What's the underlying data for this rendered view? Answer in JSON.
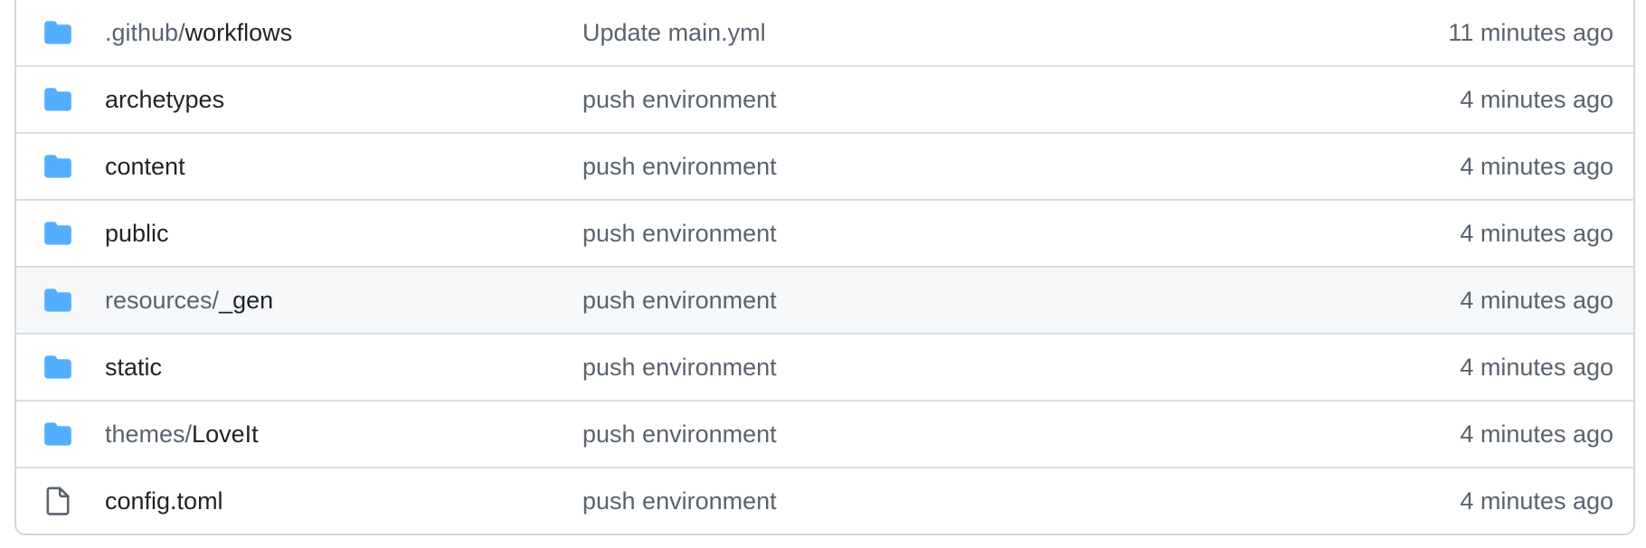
{
  "colors": {
    "folder_icon": "#54aeff",
    "file_icon": "#59636e",
    "text_primary": "#1f2328",
    "text_muted": "#59636e",
    "border": "#d0d7de",
    "hover_row": "#f6f8fa"
  },
  "rows": [
    {
      "type": "folder",
      "icon": "folder-icon",
      "prefix": ".github/",
      "name": "workflows",
      "message": "Update main.yml",
      "age": "11 minutes ago"
    },
    {
      "type": "folder",
      "icon": "folder-icon",
      "prefix": "",
      "name": "archetypes",
      "message": "push environment",
      "age": "4 minutes ago"
    },
    {
      "type": "folder",
      "icon": "folder-icon",
      "prefix": "",
      "name": "content",
      "message": "push environment",
      "age": "4 minutes ago"
    },
    {
      "type": "folder",
      "icon": "folder-icon",
      "prefix": "",
      "name": "public",
      "message": "push environment",
      "age": "4 minutes ago"
    },
    {
      "type": "folder",
      "icon": "folder-icon",
      "prefix": "resources/",
      "name": "_gen",
      "message": "push environment",
      "age": "4 minutes ago",
      "hovered": true
    },
    {
      "type": "folder",
      "icon": "folder-icon",
      "prefix": "",
      "name": "static",
      "message": "push environment",
      "age": "4 minutes ago"
    },
    {
      "type": "folder",
      "icon": "folder-icon",
      "prefix": "themes/",
      "name": "LoveIt",
      "message": "push environment",
      "age": "4 minutes ago"
    },
    {
      "type": "file",
      "icon": "file-icon",
      "prefix": "",
      "name": "config.toml",
      "message": "push environment",
      "age": "4 minutes ago"
    }
  ]
}
